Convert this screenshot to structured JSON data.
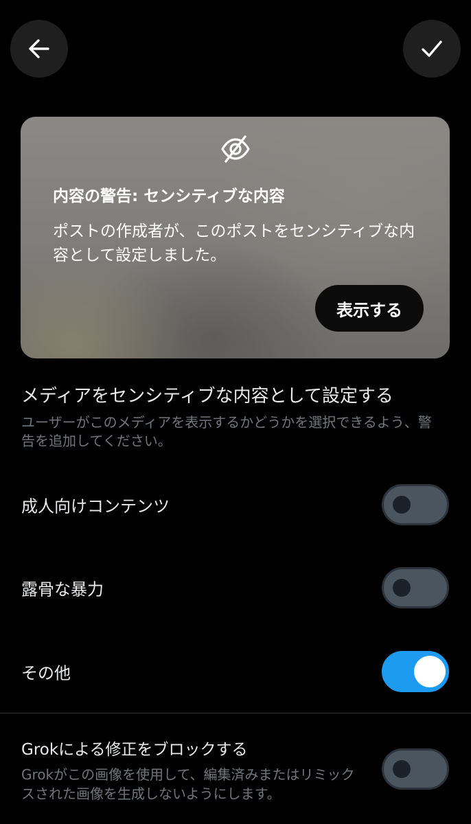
{
  "header": {
    "back_icon": "arrow-left-icon",
    "confirm_icon": "checkmark-icon"
  },
  "preview": {
    "icon": "eye-slash-icon",
    "warning_title": "内容の警告: センシティブな内容",
    "warning_body": "ポストの作成者が、このポストをセンシティブな内容として設定しました。",
    "show_button_label": "表示する"
  },
  "sensitive_section": {
    "title": "メディアをセンシティブな内容として設定する",
    "description": "ユーザーがこのメディアを表示するかどうかを選択できるよう、警告を追加してください。",
    "options": [
      {
        "label": "成人向けコンテンツ",
        "enabled": false
      },
      {
        "label": "露骨な暴力",
        "enabled": false
      },
      {
        "label": "その他",
        "enabled": true
      }
    ]
  },
  "grok_section": {
    "title": "Grokによる修正をブロックする",
    "description": "Grokがこの画像を使用して、編集済みまたはリミックスされた画像を生成しないようにします。",
    "enabled": false
  },
  "colors": {
    "accent": "#1d9bf0",
    "background": "#000000",
    "secondary_text": "#71767b",
    "toggle_off": "#4a5560"
  }
}
